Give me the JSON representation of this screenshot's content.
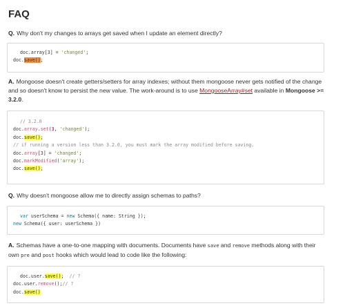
{
  "heading": "FAQ",
  "q1": {
    "tag": "Q.",
    "text": "Why don't my changes to arrays get saved when I update an element directly?"
  },
  "code1": {
    "l1_a": "doc.",
    "l1_b": "array",
    "l1_c": "[",
    "l1_d": "3",
    "l1_e": "] = ",
    "l1_f": "'changed'",
    "l1_g": ";",
    "l2_a": "doc.",
    "l2_b": "save()",
    "l2_c": ";"
  },
  "a1": {
    "tag": "A.",
    "text_1": "Mongoose doesn't create getters/setters for array indexes; without them mongoose never gets notified of the change and so doesn't know to persist the new value. The work-around is to use ",
    "link": "MongooseArray#set",
    "text_2": " available in ",
    "bold": "Mongoose >= 3.2.0",
    "text_3": "."
  },
  "code2": {
    "l1": "// 3.2.0",
    "l2_a": "doc.",
    "l2_b": "array",
    "l2_c": ".",
    "l2_d": "set",
    "l2_e": "(",
    "l2_f": "3",
    "l2_g": ", ",
    "l2_h": "'changed'",
    "l2_i": ");",
    "l3_a": "doc.",
    "l3_b": "save()",
    "l3_c": ";",
    "l4": "// if running a version less than 3.2.0, you must mark the array modified before saving.",
    "l5_a": "doc.",
    "l5_b": "array",
    "l5_c": "[",
    "l5_d": "3",
    "l5_e": "] = ",
    "l5_f": "'changed'",
    "l5_g": ";",
    "l6_a": "doc.",
    "l6_b": "markModified",
    "l6_c": "(",
    "l6_d": "'array'",
    "l6_e": ");",
    "l7_a": "doc.",
    "l7_b": "save()",
    "l7_c": ";"
  },
  "q2": {
    "tag": "Q.",
    "text": "Why doesn't mongoose allow me to directly assign schemas to paths?"
  },
  "code3": {
    "l1_a": "var",
    "l1_b": " userSchema = ",
    "l1_c": "new",
    "l1_d": " Schema({ name: String });",
    "l2_a": "new",
    "l2_b": " Schema({ user: userSchema })"
  },
  "a2": {
    "tag": "A.",
    "text_1": "Schemas have a one-to-one mapping with documents. Documents have ",
    "code_save": "save",
    "text_2": " and ",
    "code_remove": "remove",
    "text_3": " methods along with their own ",
    "code_pre": "pre",
    "text_4": " and ",
    "code_post": "post",
    "text_5": " hooks which would lead to code like the following:"
  },
  "code4": {
    "l1_a": "doc.user.",
    "l1_b": "save()",
    "l1_c": ";  ",
    "l1_d": "// ?",
    "l2_a": "doc.user.",
    "l2_b": "remove",
    "l2_c": "();",
    "l2_d": "// ?",
    "l3_a": "doc.",
    "l3_b": "save()"
  }
}
